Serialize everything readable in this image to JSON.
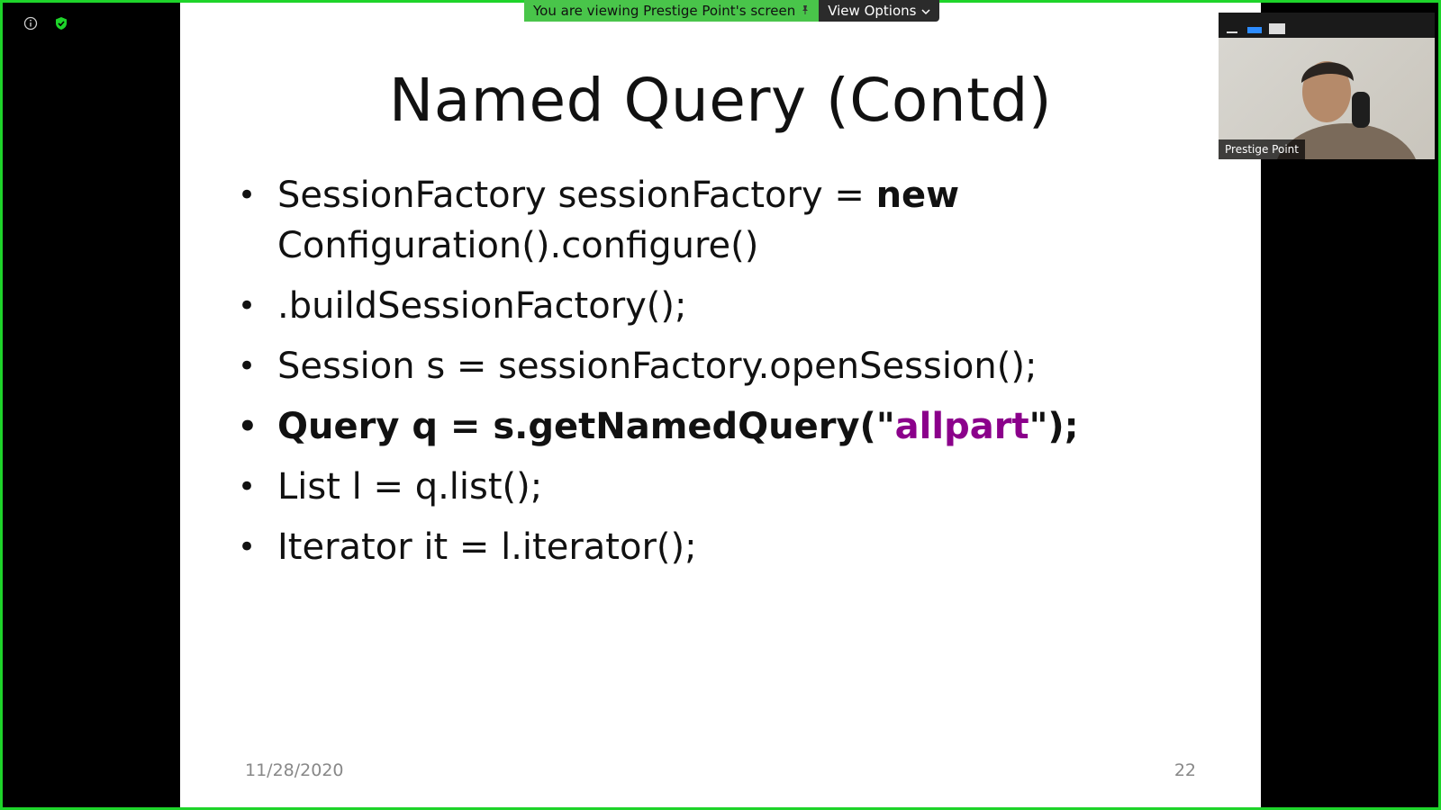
{
  "colors": {
    "border": "#1ed42a",
    "highlight": "#8b008b",
    "banner": "#49c54a"
  },
  "top_icons": [
    "info-icon",
    "shield-check-icon"
  ],
  "banner": {
    "text": "You are viewing Prestige Point's screen",
    "view_options": "View Options"
  },
  "slide": {
    "title": "Named Query (Contd)",
    "bullets": [
      {
        "pre": "SessionFactory sessionFactory = ",
        "kw": "new",
        "line2": "Configuration().configure()"
      },
      {
        "text": ".buildSessionFactory();"
      },
      {
        "text": "Session s = sessionFactory.openSession();"
      },
      {
        "pre": "Query q = s.getNamedQuery(\"",
        "hl": "allpart",
        "post": "\");"
      },
      {
        "text": "List l = q.list();"
      },
      {
        "text": "Iterator it = l.iterator();"
      }
    ],
    "footer_date": "11/28/2020",
    "page_number": "22"
  },
  "video": {
    "participant_name": "Prestige Point",
    "controls": [
      "minimize-icon",
      "speaker-view-icon",
      "gallery-view-icon"
    ]
  }
}
